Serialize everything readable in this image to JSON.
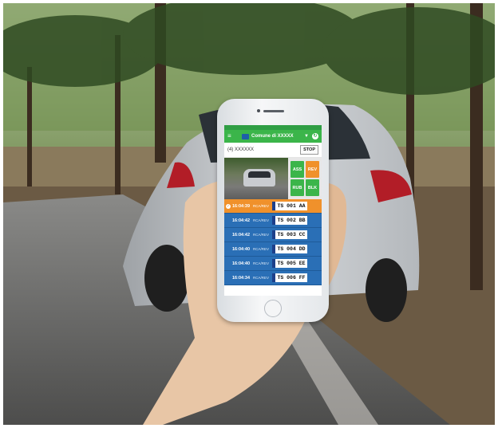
{
  "app": {
    "title": "Comune di XXXXX",
    "counter": "(4) XXXXXX",
    "stop_label": "STOP"
  },
  "actions": [
    "ASS",
    "REV",
    "RUB",
    "BLK"
  ],
  "readings": [
    {
      "time": "16:04:39",
      "type": "RCA/REV",
      "plate": "TS 001 AA",
      "highlighted": true
    },
    {
      "time": "16:04:42",
      "type": "RCA/REV",
      "plate": "TS 002 BB",
      "highlighted": false
    },
    {
      "time": "16:04:42",
      "type": "RCA/REV",
      "plate": "TS 003 CC",
      "highlighted": false
    },
    {
      "time": "16:04:40",
      "type": "RCA/REV",
      "plate": "TS 004 DD",
      "highlighted": false
    },
    {
      "time": "16:04:40",
      "type": "RCA/REV",
      "plate": "TS 005 EE",
      "highlighted": false
    },
    {
      "time": "16:04:34",
      "type": "RCA/REV",
      "plate": "TS 006 FF",
      "highlighted": false
    }
  ],
  "colors": {
    "accent": "#3bb54a",
    "highlight": "#f0912b",
    "list_bg": "#2a6fb6"
  }
}
